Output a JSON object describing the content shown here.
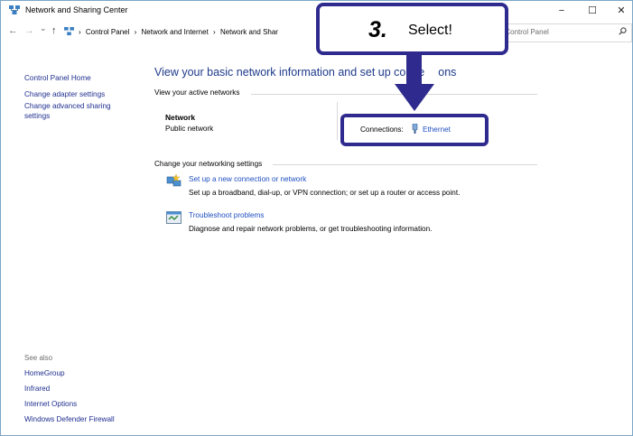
{
  "window": {
    "title": "Network and Sharing Center",
    "minimize": "−",
    "maximize": "☐",
    "close": "✕"
  },
  "address": {
    "back": "←",
    "forward": "→",
    "dropdown": "⌄",
    "up": "↑",
    "breadcrumbs": [
      "Control Panel",
      "Network and Internet",
      "Network and Shar"
    ],
    "separator": "›",
    "search_placeholder": "rch Control Panel"
  },
  "sidebar": {
    "items": [
      {
        "label": "Control Panel Home"
      },
      {
        "label": "Change adapter settings"
      },
      {
        "label": "Change advanced sharing"
      },
      {
        "label": "settings"
      }
    ],
    "see_also": "See also",
    "see_also_links": [
      {
        "label": "HomeGroup"
      },
      {
        "label": "Infrared"
      },
      {
        "label": "Internet Options"
      },
      {
        "label": "Windows Defender Firewall"
      }
    ]
  },
  "main": {
    "heading": "View your basic network information and set up conne",
    "heading_tail": "ons",
    "active_label": "View your active networks",
    "network_name": "Network",
    "network_type": "Public network",
    "connections_label": "Connections:",
    "connection_name": "Ethernet",
    "change_label": "Change your networking settings",
    "tasks": [
      {
        "title": "Set up a new connection or network",
        "desc": "Set up a broadband, dial-up, or VPN connection; or set up a router or access point."
      },
      {
        "title": "Troubleshoot problems",
        "desc": "Diagnose and repair network problems, or get troubleshooting information."
      }
    ]
  },
  "callout": {
    "step": "3.",
    "text": "Select!",
    "color": "#2e2a8e"
  }
}
